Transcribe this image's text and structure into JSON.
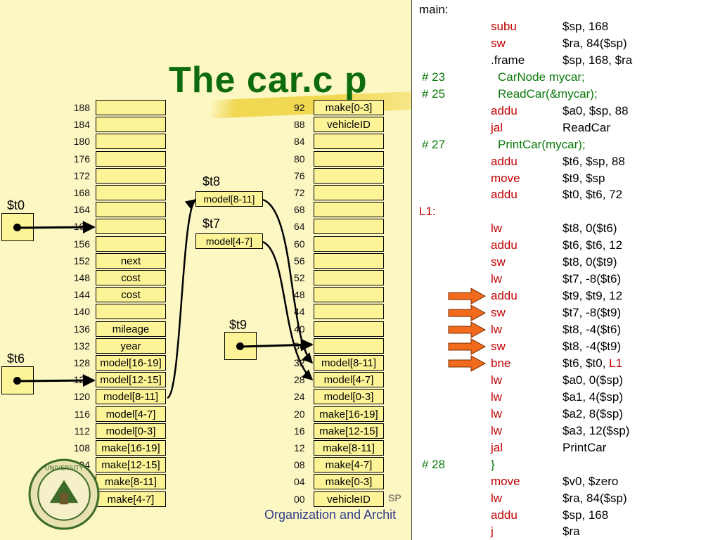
{
  "title": "The car.c p",
  "footer": {
    "text": "Organization and Archit",
    "partial": "SP"
  },
  "left_stack": [
    {
      "addr": "188",
      "label": ""
    },
    {
      "addr": "184",
      "label": ""
    },
    {
      "addr": "180",
      "label": ""
    },
    {
      "addr": "176",
      "label": ""
    },
    {
      "addr": "172",
      "label": ""
    },
    {
      "addr": "168",
      "label": ""
    },
    {
      "addr": "164",
      "label": ""
    },
    {
      "addr": "160",
      "label": ""
    },
    {
      "addr": "156",
      "label": ""
    },
    {
      "addr": "152",
      "label": "next"
    },
    {
      "addr": "148",
      "label": "cost"
    },
    {
      "addr": "144",
      "label": "cost"
    },
    {
      "addr": "140",
      "label": ""
    },
    {
      "addr": "136",
      "label": "mileage"
    },
    {
      "addr": "132",
      "label": "year"
    },
    {
      "addr": "128",
      "label": "model[16-19]"
    },
    {
      "addr": "124",
      "label": "model[12-15]"
    },
    {
      "addr": "120",
      "label": "model[8-11]"
    },
    {
      "addr": "116",
      "label": "model[4-7]"
    },
    {
      "addr": "112",
      "label": "model[0-3]"
    },
    {
      "addr": "108",
      "label": "make[16-19]"
    },
    {
      "addr": "104",
      "label": "make[12-15]"
    },
    {
      "addr": "100",
      "label": "make[8-11]"
    },
    {
      "addr": "96",
      "label": "make[4-7]"
    }
  ],
  "right_stack": [
    {
      "addr": "92",
      "label": "make[0-3]"
    },
    {
      "addr": "88",
      "label": "vehicleID"
    },
    {
      "addr": "84",
      "label": ""
    },
    {
      "addr": "80",
      "label": ""
    },
    {
      "addr": "76",
      "label": ""
    },
    {
      "addr": "72",
      "label": ""
    },
    {
      "addr": "68",
      "label": ""
    },
    {
      "addr": "64",
      "label": ""
    },
    {
      "addr": "60",
      "label": ""
    },
    {
      "addr": "56",
      "label": ""
    },
    {
      "addr": "52",
      "label": ""
    },
    {
      "addr": "48",
      "label": ""
    },
    {
      "addr": "44",
      "label": ""
    },
    {
      "addr": "40",
      "label": ""
    },
    {
      "addr": "36",
      "label": ""
    },
    {
      "addr": "32",
      "label": "model[8-11]"
    },
    {
      "addr": "28",
      "label": "model[4-7]"
    },
    {
      "addr": "24",
      "label": "model[0-3]"
    },
    {
      "addr": "20",
      "label": "make[16-19]"
    },
    {
      "addr": "16",
      "label": "make[12-15]"
    },
    {
      "addr": "12",
      "label": "make[8-11]"
    },
    {
      "addr": "08",
      "label": "make[4-7]"
    },
    {
      "addr": "04",
      "label": "make[0-3]"
    },
    {
      "addr": "00",
      "label": "vehicleID"
    }
  ],
  "registers": {
    "t0": "$t0",
    "t6": "$t6",
    "t9": "$t9",
    "t8": "$t8",
    "t7": "$t7",
    "t8_value": "model[8-11]",
    "t7_value": "model[4-7]"
  },
  "code": [
    {
      "label": "main:"
    },
    {
      "op": "subu",
      "arg": "$sp, 168"
    },
    {
      "op": "sw",
      "arg": "$ra, 84($sp)"
    },
    {
      "op": ".frame",
      "arg": "$sp, 168, $ra",
      "op_color": "black"
    },
    {
      "num": "#  23",
      "src": "CarNode mycar;"
    },
    {
      "num": "#  25",
      "src": "ReadCar(&mycar);"
    },
    {
      "op": "addu",
      "arg": "$a0, $sp, 88"
    },
    {
      "op": "jal",
      "arg": "ReadCar"
    },
    {
      "num": "#  27",
      "src": "PrintCar(mycar);"
    },
    {
      "op": "addu",
      "arg": "$t6, $sp, 88"
    },
    {
      "op": "move",
      "arg": "$t9, $sp"
    },
    {
      "op": "addu",
      "arg": "$t0, $t6, 72"
    },
    {
      "label": "L1:",
      "label_color": "red"
    },
    {
      "op": "lw",
      "arg": "$t8, 0($t6)"
    },
    {
      "op": "addu",
      "arg": "$t6, $t6, 12"
    },
    {
      "op": "sw",
      "arg": "$t8, 0($t9)"
    },
    {
      "op": "lw",
      "arg": "$t7, -8($t6)"
    },
    {
      "op": "addu",
      "arg": "$t9, $t9, 12",
      "marked": true
    },
    {
      "op": "sw",
      "arg": "$t7, -8($t9)",
      "marked": true
    },
    {
      "op": "lw",
      "arg": "$t8, -4($t6)",
      "marked": true
    },
    {
      "op": "sw",
      "arg": "$t8, -4($t9)",
      "marked": true
    },
    {
      "op": "bne",
      "arg": "$t6, $t0, ",
      "arg_red": "L1",
      "marked": true
    },
    {
      "op": "lw",
      "arg": "$a0, 0($sp)"
    },
    {
      "op": "lw",
      "arg": "$a1, 4($sp)"
    },
    {
      "op": "lw",
      "arg": "$a2, 8($sp)"
    },
    {
      "op": "lw",
      "arg": "$a3, 12($sp)"
    },
    {
      "op": "jal",
      "arg": "PrintCar"
    },
    {
      "num": "#  28",
      "op": "}",
      "op_color": "green"
    },
    {
      "op": "move",
      "arg": "$v0, $zero"
    },
    {
      "op": "lw",
      "arg": "$ra, 84($sp)"
    },
    {
      "op": "addu",
      "arg": "$sp, 168"
    },
    {
      "op": "j",
      "arg": "$ra"
    }
  ],
  "colors": {
    "background": "#fdf7c4",
    "cell": "#fdf498",
    "title": "#0d6b0d",
    "keyword": "#c00000",
    "comment": "#0a7a0a",
    "marker": "#f26b1d"
  }
}
